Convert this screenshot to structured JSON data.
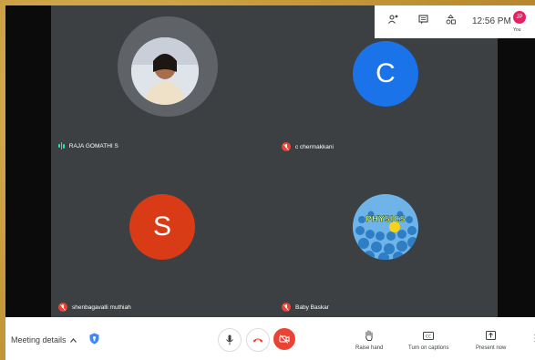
{
  "clock": "12:56 PM",
  "self": {
    "initials": "JP",
    "label": "You"
  },
  "participants": [
    {
      "name": "RAJA GOMATHI S",
      "avatar": "photo"
    },
    {
      "name": "c chermakkani",
      "initial": "C",
      "color": "#1a73e8"
    },
    {
      "name": "shenbagavalli muthiah",
      "initial": "S",
      "color": "#d93b17"
    },
    {
      "name": "Baby Baskar",
      "avatar": "physics-image",
      "avatar_text": "PHYSICS"
    }
  ],
  "bottom": {
    "meeting_details": "Meeting details",
    "raise_hand": "Raise hand",
    "captions": "Turn on captions",
    "present": "Present now"
  },
  "colors": {
    "end_call": "#ea4335",
    "mic_off": "#ea4335",
    "speaking": "#1de9b6"
  }
}
